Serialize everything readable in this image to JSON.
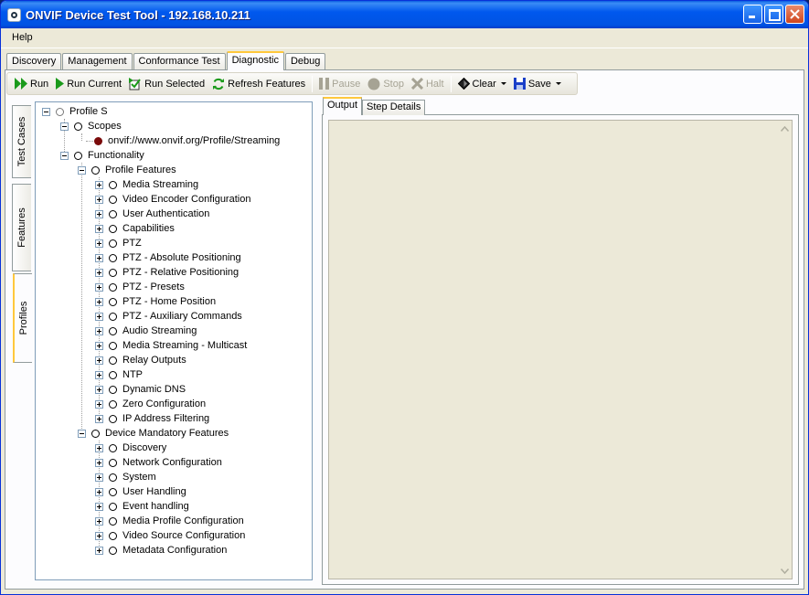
{
  "window": {
    "title": "ONVIF Device Test Tool - 192.168.10.211"
  },
  "menu": {
    "help": "Help"
  },
  "main_tabs": [
    "Discovery",
    "Management",
    "Conformance Test",
    "Diagnostic",
    "Debug"
  ],
  "toolbar": {
    "run": "Run",
    "run_current": "Run Current",
    "run_selected": "Run Selected",
    "refresh_features": "Refresh Features",
    "pause": "Pause",
    "stop": "Stop",
    "halt": "Halt",
    "clear": "Clear",
    "save": "Save"
  },
  "side_tabs": [
    "Test Cases",
    "Features",
    "Profiles"
  ],
  "tree": {
    "root": "Profile S",
    "scopes": "Scopes",
    "scope_value": "onvif://www.onvif.org/Profile/Streaming",
    "functionality": "Functionality",
    "profile_features": "Profile Features",
    "profile_feature_items": [
      "Media Streaming",
      "Video Encoder Configuration",
      "User Authentication",
      "Capabilities",
      "PTZ",
      "PTZ - Absolute Positioning",
      "PTZ -  Relative Positioning",
      "PTZ - Presets",
      "PTZ - Home Position",
      "PTZ - Auxiliary Commands",
      "Audio Streaming",
      "Media Streaming - Multicast",
      "Relay Outputs",
      "NTP",
      "Dynamic DNS",
      "Zero Configuration",
      "IP Address Filtering"
    ],
    "device_mandatory": "Device Mandatory Features",
    "device_mandatory_items": [
      "Discovery",
      "Network Configuration",
      "System",
      "User Handling",
      "Event handling",
      "Media Profile Configuration",
      "Video Source Configuration",
      "Metadata Configuration"
    ]
  },
  "output_tabs": [
    "Output",
    "Step Details"
  ]
}
